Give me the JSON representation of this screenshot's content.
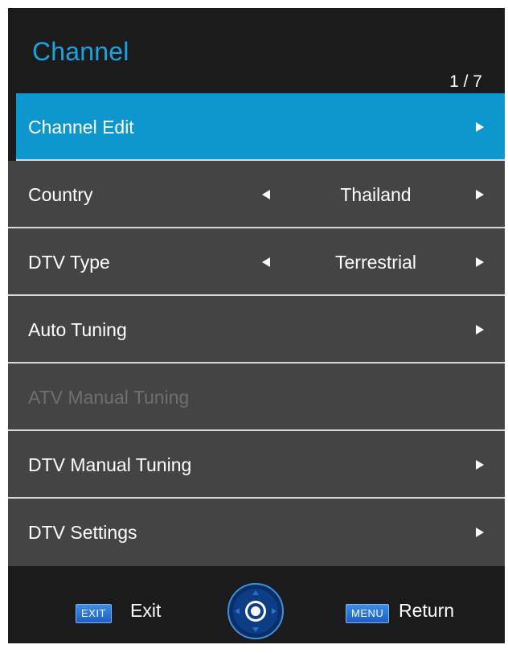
{
  "header": {
    "title": "Channel",
    "page_indicator": "1 / 7"
  },
  "menu": {
    "items": [
      {
        "label": "Channel Edit",
        "state": "selected"
      },
      {
        "label": "Country",
        "value": "Thailand"
      },
      {
        "label": "DTV Type",
        "value": "Terrestrial"
      },
      {
        "label": "Auto Tuning"
      },
      {
        "label": "ATV Manual Tuning",
        "state": "disabled"
      },
      {
        "label": "DTV Manual Tuning"
      },
      {
        "label": "DTV Settings"
      }
    ]
  },
  "footer": {
    "exit_key": "EXIT",
    "exit_label": "Exit",
    "menu_key": "MENU",
    "return_label": "Return",
    "nav_icon": "dpad-ok-icon"
  },
  "colors": {
    "accent": "#1aa2e2",
    "selected_bg": "#0e97cf",
    "item_bg": "#444444",
    "panel_bg": "#1b1b1b",
    "disabled_text": "#6f6f6f"
  }
}
